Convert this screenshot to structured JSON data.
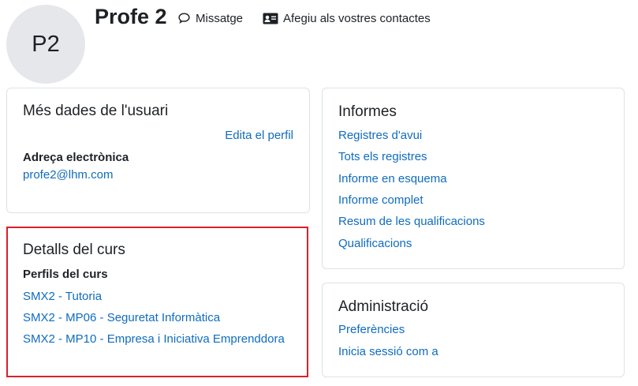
{
  "header": {
    "avatar_initials": "P2",
    "user_name": "Profe 2",
    "message_label": "Missatge",
    "add_contact_label": "Afegiu als vostres contactes"
  },
  "user_details": {
    "title": "Més dades de l'usuari",
    "edit_profile_link": "Edita el perfil",
    "email_label": "Adreça electrònica",
    "email_value": "profe2@lhm.com"
  },
  "course_details": {
    "title": "Detalls del curs",
    "profiles_label": "Perfils del curs",
    "courses": [
      "SMX2 - Tutoria",
      "SMX2 - MP06 - Seguretat Informàtica",
      "SMX2 - MP10 - Empresa i Iniciativa Emprenddora"
    ]
  },
  "reports": {
    "title": "Informes",
    "links": [
      "Registres d'avui",
      "Tots els registres",
      "Informe en esquema",
      "Informe complet",
      "Resum de les qualificacions",
      "Qualificacions"
    ]
  },
  "administration": {
    "title": "Administració",
    "links": [
      "Preferències",
      "Inicia sessió com a"
    ]
  },
  "colors": {
    "link": "#0f6cbf",
    "highlight_border": "#d9202a",
    "avatar_bg": "#e5e7ea"
  }
}
